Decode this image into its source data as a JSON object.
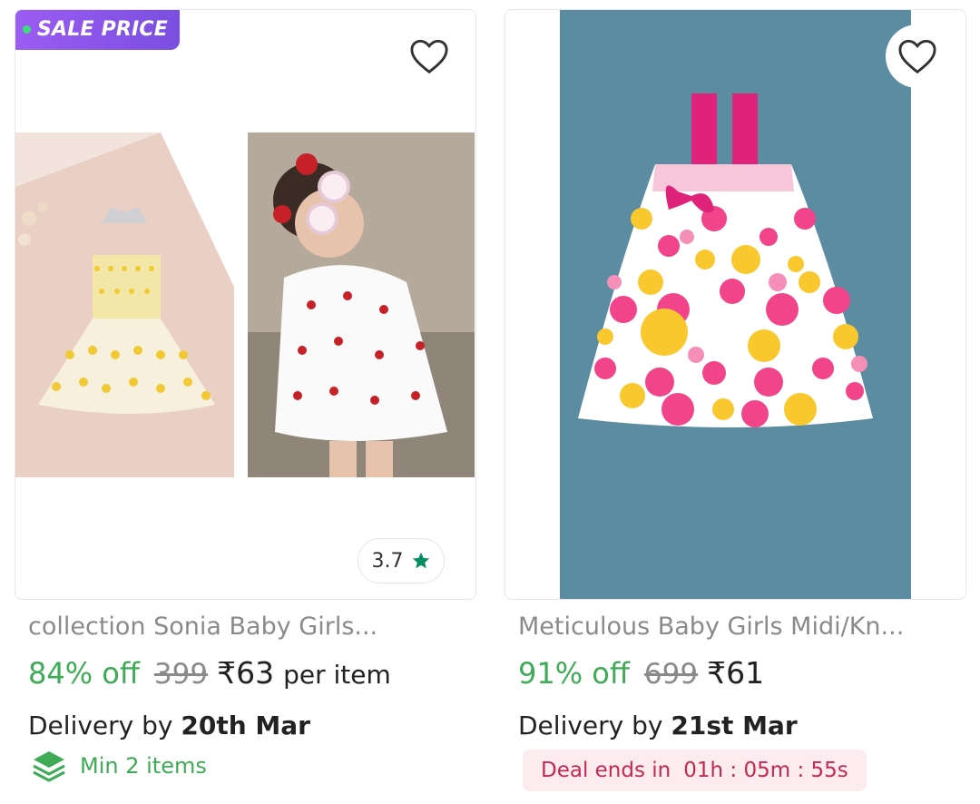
{
  "products": [
    {
      "badge": "SALE PRICE",
      "title": "collection Sonia Baby Girls...",
      "discount": "84% off",
      "mrp": "399",
      "price": "₹63",
      "per_unit": "per item",
      "delivery_prefix": "Delivery by",
      "delivery_date": "20th Mar",
      "rating": "3.7",
      "min_items": "Min 2 items",
      "icons": [
        "heart-outline-icon",
        "star-icon",
        "layers-icon"
      ]
    },
    {
      "title": "Meticulous Baby Girls Midi/Kn...",
      "discount": "91% off",
      "mrp": "699",
      "price": "₹61",
      "delivery_prefix": "Delivery by",
      "delivery_date": "21st Mar",
      "deal_label": "Deal ends in",
      "deal_timer": "01h : 05m : 55s",
      "icons": [
        "heart-outline-icon"
      ]
    }
  ],
  "colors": {
    "discount": "#3eab56",
    "badge": "#8a55ea",
    "deal_bg": "#fdecef",
    "deal_text": "#c22a55",
    "photo_teal": "#5b8ca1"
  }
}
